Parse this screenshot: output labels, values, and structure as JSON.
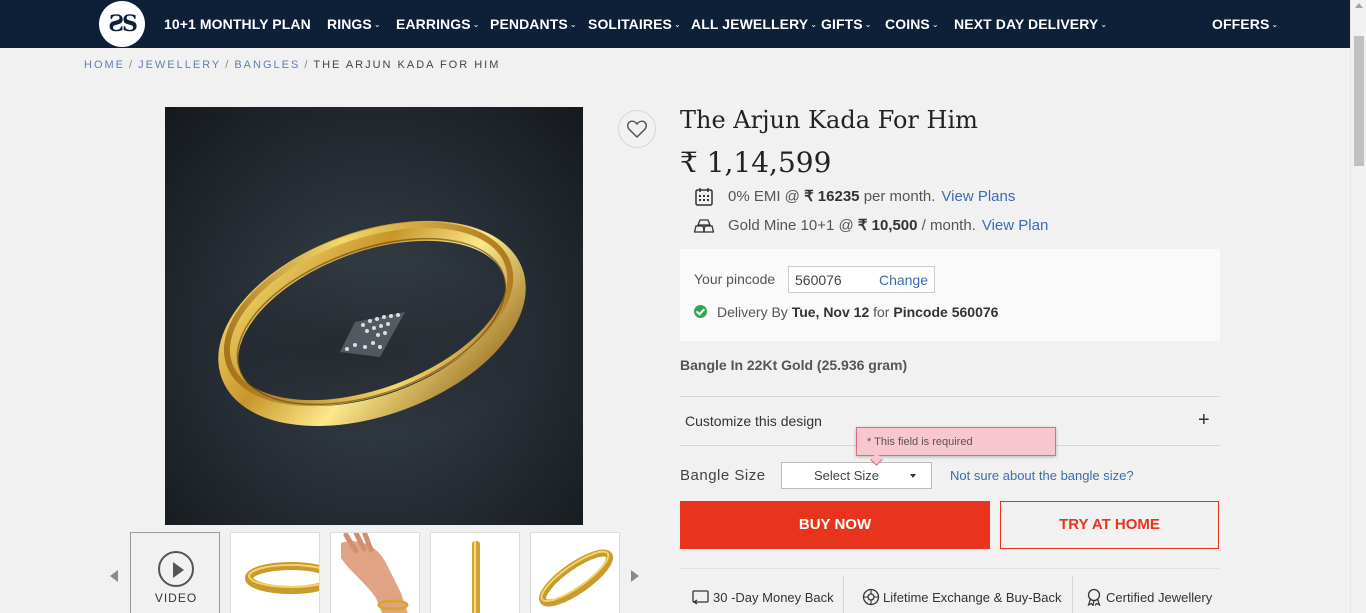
{
  "brand": {
    "logo_text": "ƧS"
  },
  "nav": {
    "items": [
      {
        "label": "10+1 MONTHLY PLAN",
        "has_caret": false
      },
      {
        "label": "RINGS",
        "has_caret": true
      },
      {
        "label": "EARRINGS",
        "has_caret": true
      },
      {
        "label": "PENDANTS",
        "has_caret": true
      },
      {
        "label": "SOLITAIRES",
        "has_caret": true
      },
      {
        "label": "ALL JEWELLERY",
        "has_caret": true
      },
      {
        "label": "GIFTS",
        "has_caret": true
      },
      {
        "label": "COINS",
        "has_caret": true
      },
      {
        "label": "NEXT DAY DELIVERY",
        "has_caret": true
      },
      {
        "label": "OFFERS",
        "has_caret": true
      }
    ],
    "caret": "⌄"
  },
  "breadcrumb": {
    "items": [
      "HOME",
      "JEWELLERY",
      "BANGLES"
    ],
    "separator": "/",
    "current": "THE ARJUN KADA FOR HIM"
  },
  "gallery": {
    "video_label": "VIDEO",
    "thumbnails": [
      "video-icon",
      "bangle-side",
      "bangle-on-wrist",
      "bangle-edge",
      "bangle-angle"
    ]
  },
  "product": {
    "title": "The Arjun Kada For Him",
    "price": "₹ 1,14,599",
    "emi": {
      "prefix": "0% EMI @",
      "amount": "₹ 16235",
      "suffix": "per month.",
      "link": "View Plans"
    },
    "gold_mine": {
      "prefix": "Gold Mine 10+1 @",
      "amount": "₹ 10,500",
      "suffix": "/ month.",
      "link": "View Plan"
    },
    "pincode": {
      "label": "Your pincode",
      "value": "560076",
      "change": "Change"
    },
    "delivery": {
      "prefix": "Delivery By",
      "date": "Tue, Nov 12",
      "middle": "for",
      "pincode": "Pincode 560076"
    },
    "metal": "Bangle In 22Kt Gold (25.936 gram)",
    "customize_label": "Customize this design",
    "customize_icon": "+",
    "validation_error": "* This field is required",
    "size": {
      "label": "Bangle Size",
      "selected": "Select Size",
      "help_link": "Not sure about the bangle size?"
    },
    "buy_now": "BUY NOW",
    "try_at_home": "TRY AT HOME"
  },
  "assurances": [
    {
      "label": "30 -Day Money Back",
      "icon": "return-icon"
    },
    {
      "label": "Lifetime Exchange & Buy-Back",
      "icon": "exchange-icon"
    },
    {
      "label": "Certified Jewellery",
      "icon": "certificate-icon"
    }
  ],
  "colors": {
    "nav_bg": "#0e1f38",
    "accent": "#e8341c",
    "link": "#3d6bb3",
    "success": "#2fa84f",
    "error_bg": "#f8c6cf"
  }
}
